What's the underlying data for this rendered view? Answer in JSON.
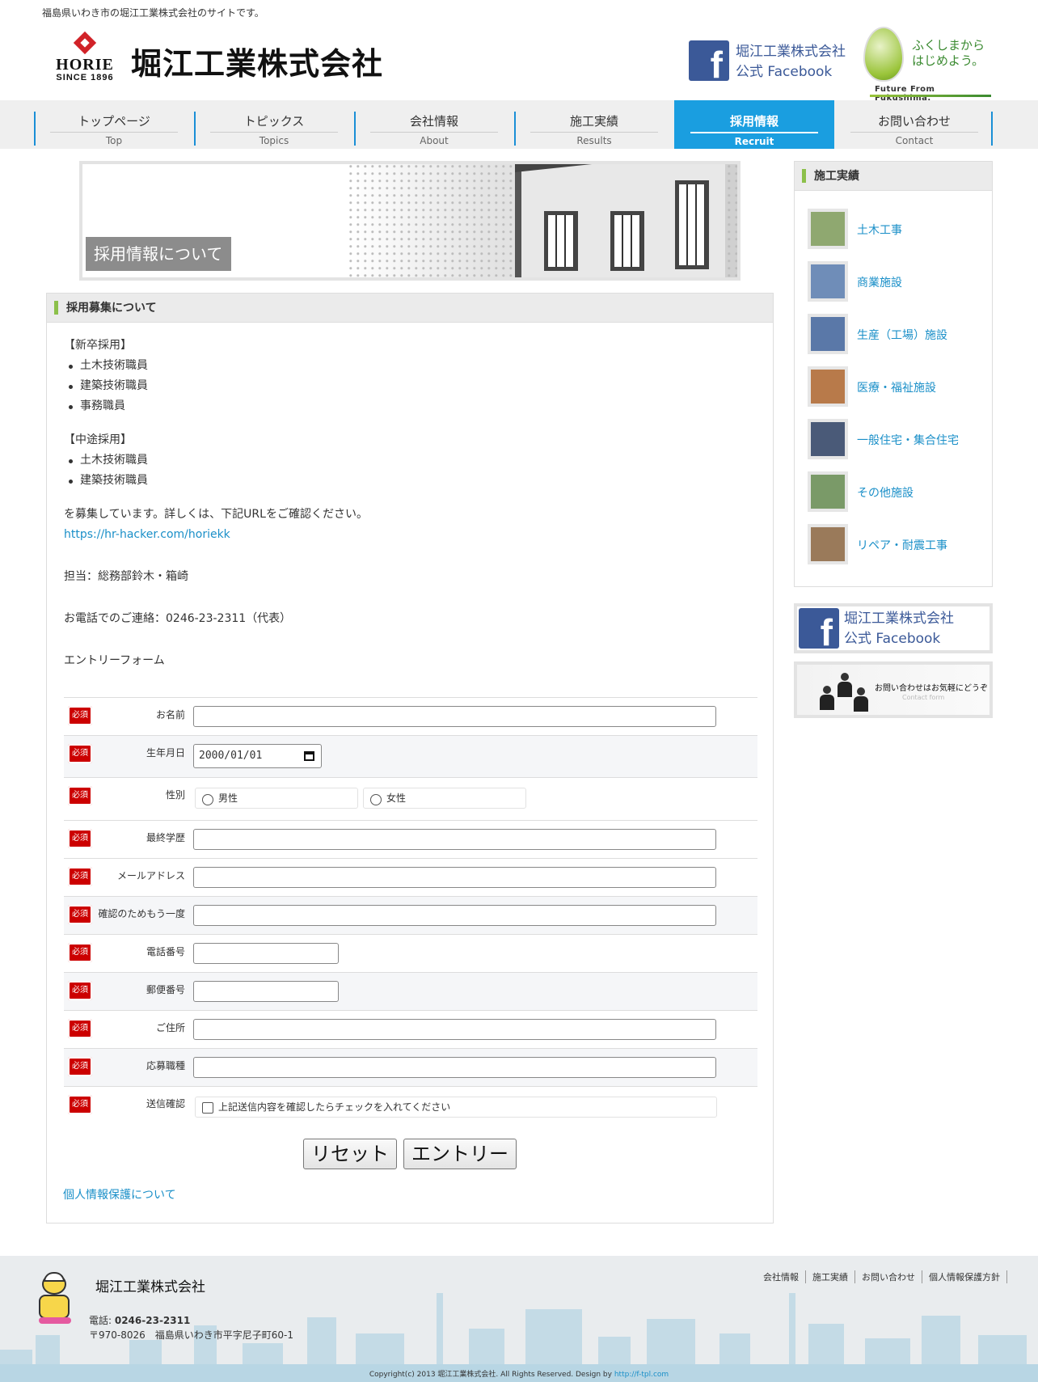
{
  "top_text": "福島県いわき市の堀江工業株式会社のサイトです。",
  "logo": {
    "brand": "HORIE",
    "since": "SINCE 1896",
    "name": "堀江工業株式会社"
  },
  "facebook": {
    "line1": "堀江工業株式会社",
    "line2": "公式 Facebook",
    "glyph": "f"
  },
  "fukushima": {
    "line1": "ふくしまから",
    "line2": "はじめよう。",
    "sub": "Future From Fukushima."
  },
  "nav": [
    {
      "jp": "トップページ",
      "en": "Top"
    },
    {
      "jp": "トピックス",
      "en": "Topics"
    },
    {
      "jp": "会社情報",
      "en": "About"
    },
    {
      "jp": "施工実績",
      "en": "Results"
    },
    {
      "jp": "採用情報",
      "en": "Recruit"
    },
    {
      "jp": "お問い合わせ",
      "en": "Contact"
    }
  ],
  "hero": {
    "label": "採用情報について"
  },
  "main": {
    "heading": "採用募集について",
    "new_grad_title": "【新卒採用】",
    "new_grad": [
      "土木技術職員",
      "建築技術職員",
      "事務職員"
    ],
    "mid_career_title": "【中途採用】",
    "mid_career": [
      "土木技術職員",
      "建築技術職員"
    ],
    "recruit_text": "を募集しています。詳しくは、下記URLをご確認ください。",
    "recruit_url": "https://hr-hacker.com/horiekk",
    "contact_person": "担当：総務部鈴木・箱崎",
    "phone_text": "お電話でのご連絡：0246-23-2311（代表）",
    "form_title": "エントリーフォーム"
  },
  "form": {
    "required": "必須",
    "fields": {
      "name": "お名前",
      "birthday": "生年月日",
      "gender": "性別",
      "education": "最終学歴",
      "email": "メールアドレス",
      "email_confirm": "確認のためもう一度",
      "phone": "電話番号",
      "postal": "郵便番号",
      "address": "ご住所",
      "position": "応募職種",
      "confirm": "送信確認"
    },
    "birthday_value": "2000/01/01",
    "gender_options": [
      "男性",
      "女性"
    ],
    "confirm_checkbox": "上記送信内容を確認したらチェックを入れてください",
    "reset_button": "リセット",
    "entry_button": "エントリー",
    "privacy_link": "個人情報保護について"
  },
  "sidebar": {
    "heading": "施工実績",
    "items": [
      {
        "label": "土木工事",
        "color": "#8fa870"
      },
      {
        "label": "商業施設",
        "color": "#6f8db8"
      },
      {
        "label": "生産（工場）施設",
        "color": "#5a78a8"
      },
      {
        "label": "医療・福祉施設",
        "color": "#b87a4a"
      },
      {
        "label": "一般住宅・集合住宅",
        "color": "#4a5a78"
      },
      {
        "label": "その他施設",
        "color": "#7a9a68"
      },
      {
        "label": "リペア・耐震工事",
        "color": "#9a7a5a"
      }
    ],
    "facebook": {
      "line1": "堀江工業株式会社",
      "line2": "公式 Facebook",
      "glyph": "f"
    },
    "contact_banner": {
      "text": "お問い合わせはお気軽にどうぞ",
      "sub": "Contact form"
    }
  },
  "footer": {
    "company": "堀江工業株式会社",
    "tel_label": "電話: ",
    "tel": "0246-23-2311",
    "address": "〒970-8026　福島県いわき市平字尼子町60-1",
    "links": [
      "会社情報",
      "施工実績",
      "お問い合わせ",
      "個人情報保護方針"
    ],
    "copyright": "Copyright(c) 2013 堀江工業株式会社. All Rights Reserved. Design by ",
    "design_link": "http://f-tpl.com"
  }
}
